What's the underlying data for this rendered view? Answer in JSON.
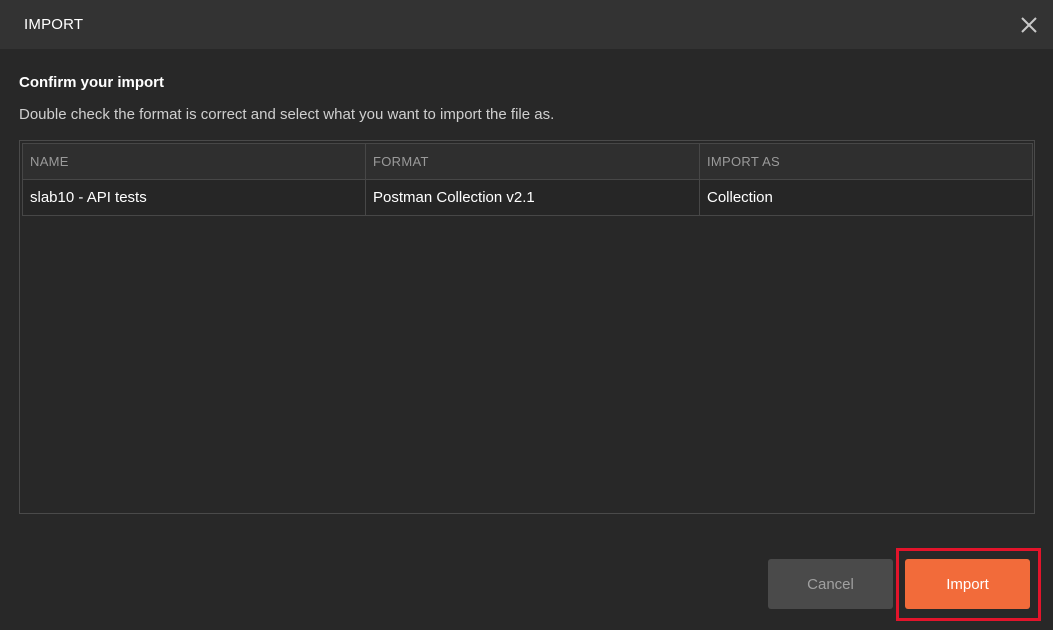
{
  "header": {
    "title": "IMPORT",
    "close_icon": "close-icon"
  },
  "confirm": {
    "title": "Confirm your import",
    "subtitle": "Double check the format is correct and select what you want to import the file as."
  },
  "table": {
    "columns": [
      "NAME",
      "FORMAT",
      "IMPORT AS"
    ],
    "rows": [
      {
        "name": "slab10 - API tests",
        "format": "Postman Collection v2.1",
        "import_as": "Collection"
      }
    ]
  },
  "footer": {
    "cancel_label": "Cancel",
    "import_label": "Import"
  },
  "colors": {
    "background": "#282828",
    "header_bg": "#333333",
    "accent": "#f26b3a",
    "highlight_border": "#e3142b",
    "cancel_bg": "#4a4a4a"
  }
}
